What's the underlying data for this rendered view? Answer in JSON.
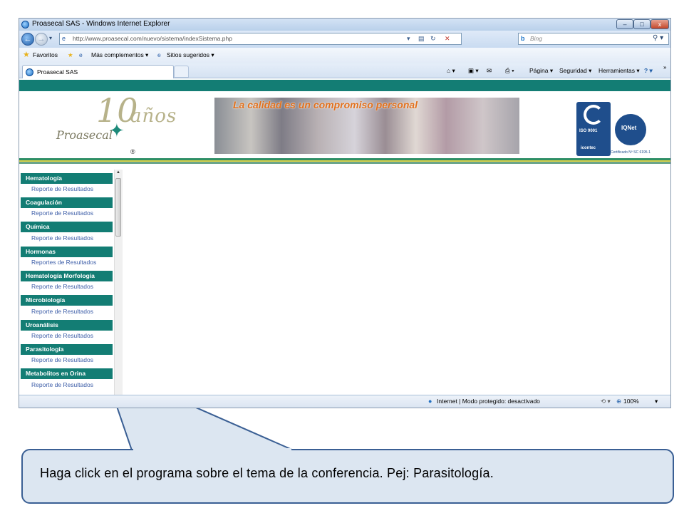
{
  "window": {
    "title": "Proasecal SAS - Windows Internet Explorer",
    "controls": {
      "minimize": "–",
      "maximize": "□",
      "close": "x"
    }
  },
  "address": {
    "url": "http://www.proasecal.com/nuevo/sistema/indexSistema.php",
    "search_placeholder": "Bing",
    "search_engine": "b"
  },
  "favorites_bar": {
    "favorites": "Favoritos",
    "more_addons": "Más complementos ▾",
    "suggested_sites": "Sitios sugeridos ▾"
  },
  "tabs": [
    {
      "label": "Proasecal SAS"
    }
  ],
  "command_bar": {
    "page": "Página ▾",
    "security": "Seguridad ▾",
    "tools": "Herramientas ▾",
    "help": "? ▾"
  },
  "header": {
    "logo_number": "10",
    "logo_years": "años",
    "logo_name": "Proasecal",
    "logo_registered": "®",
    "slogan": "La calidad es un compromiso personal",
    "iso_label": "ISO 9001",
    "icontec_label": "icontec",
    "iqnet_label": "IQNet",
    "certificate": "Certificado Nº SC 6195-1"
  },
  "menu": {
    "sections": [
      {
        "title": "Hematología",
        "link": "Reporte de Resultados"
      },
      {
        "title": "Coagulación",
        "link": "Reporte de Resultados"
      },
      {
        "title": "Química",
        "link": "Reporte de Resultados"
      },
      {
        "title": "Hormonas",
        "link": "Reportes de Resultados"
      },
      {
        "title": "Hematología Morfología",
        "link": "Reporte de Resultados"
      },
      {
        "title": "Microbiología",
        "link": "Reporte de Resultados"
      },
      {
        "title": "Uroanálisis",
        "link": "Reporte de Resultados"
      },
      {
        "title": "Parasitología",
        "link": "Reporte de Resultados"
      },
      {
        "title": "Metabolitos en Orina",
        "link": "Reporte de Resultados"
      }
    ]
  },
  "status_bar": {
    "zone": "Internet | Modo protegido: desactivado",
    "zoom": "100%"
  },
  "callout": {
    "text": "Haga click en el programa sobre el tema de la conferencia. Pej: Parasitología."
  },
  "colors": {
    "menu_header": "#137d74",
    "menu_link": "#3d5ea8",
    "slogan": "#e2711d",
    "callout_fill": "#dce6f1",
    "callout_border": "#3a5f94"
  }
}
